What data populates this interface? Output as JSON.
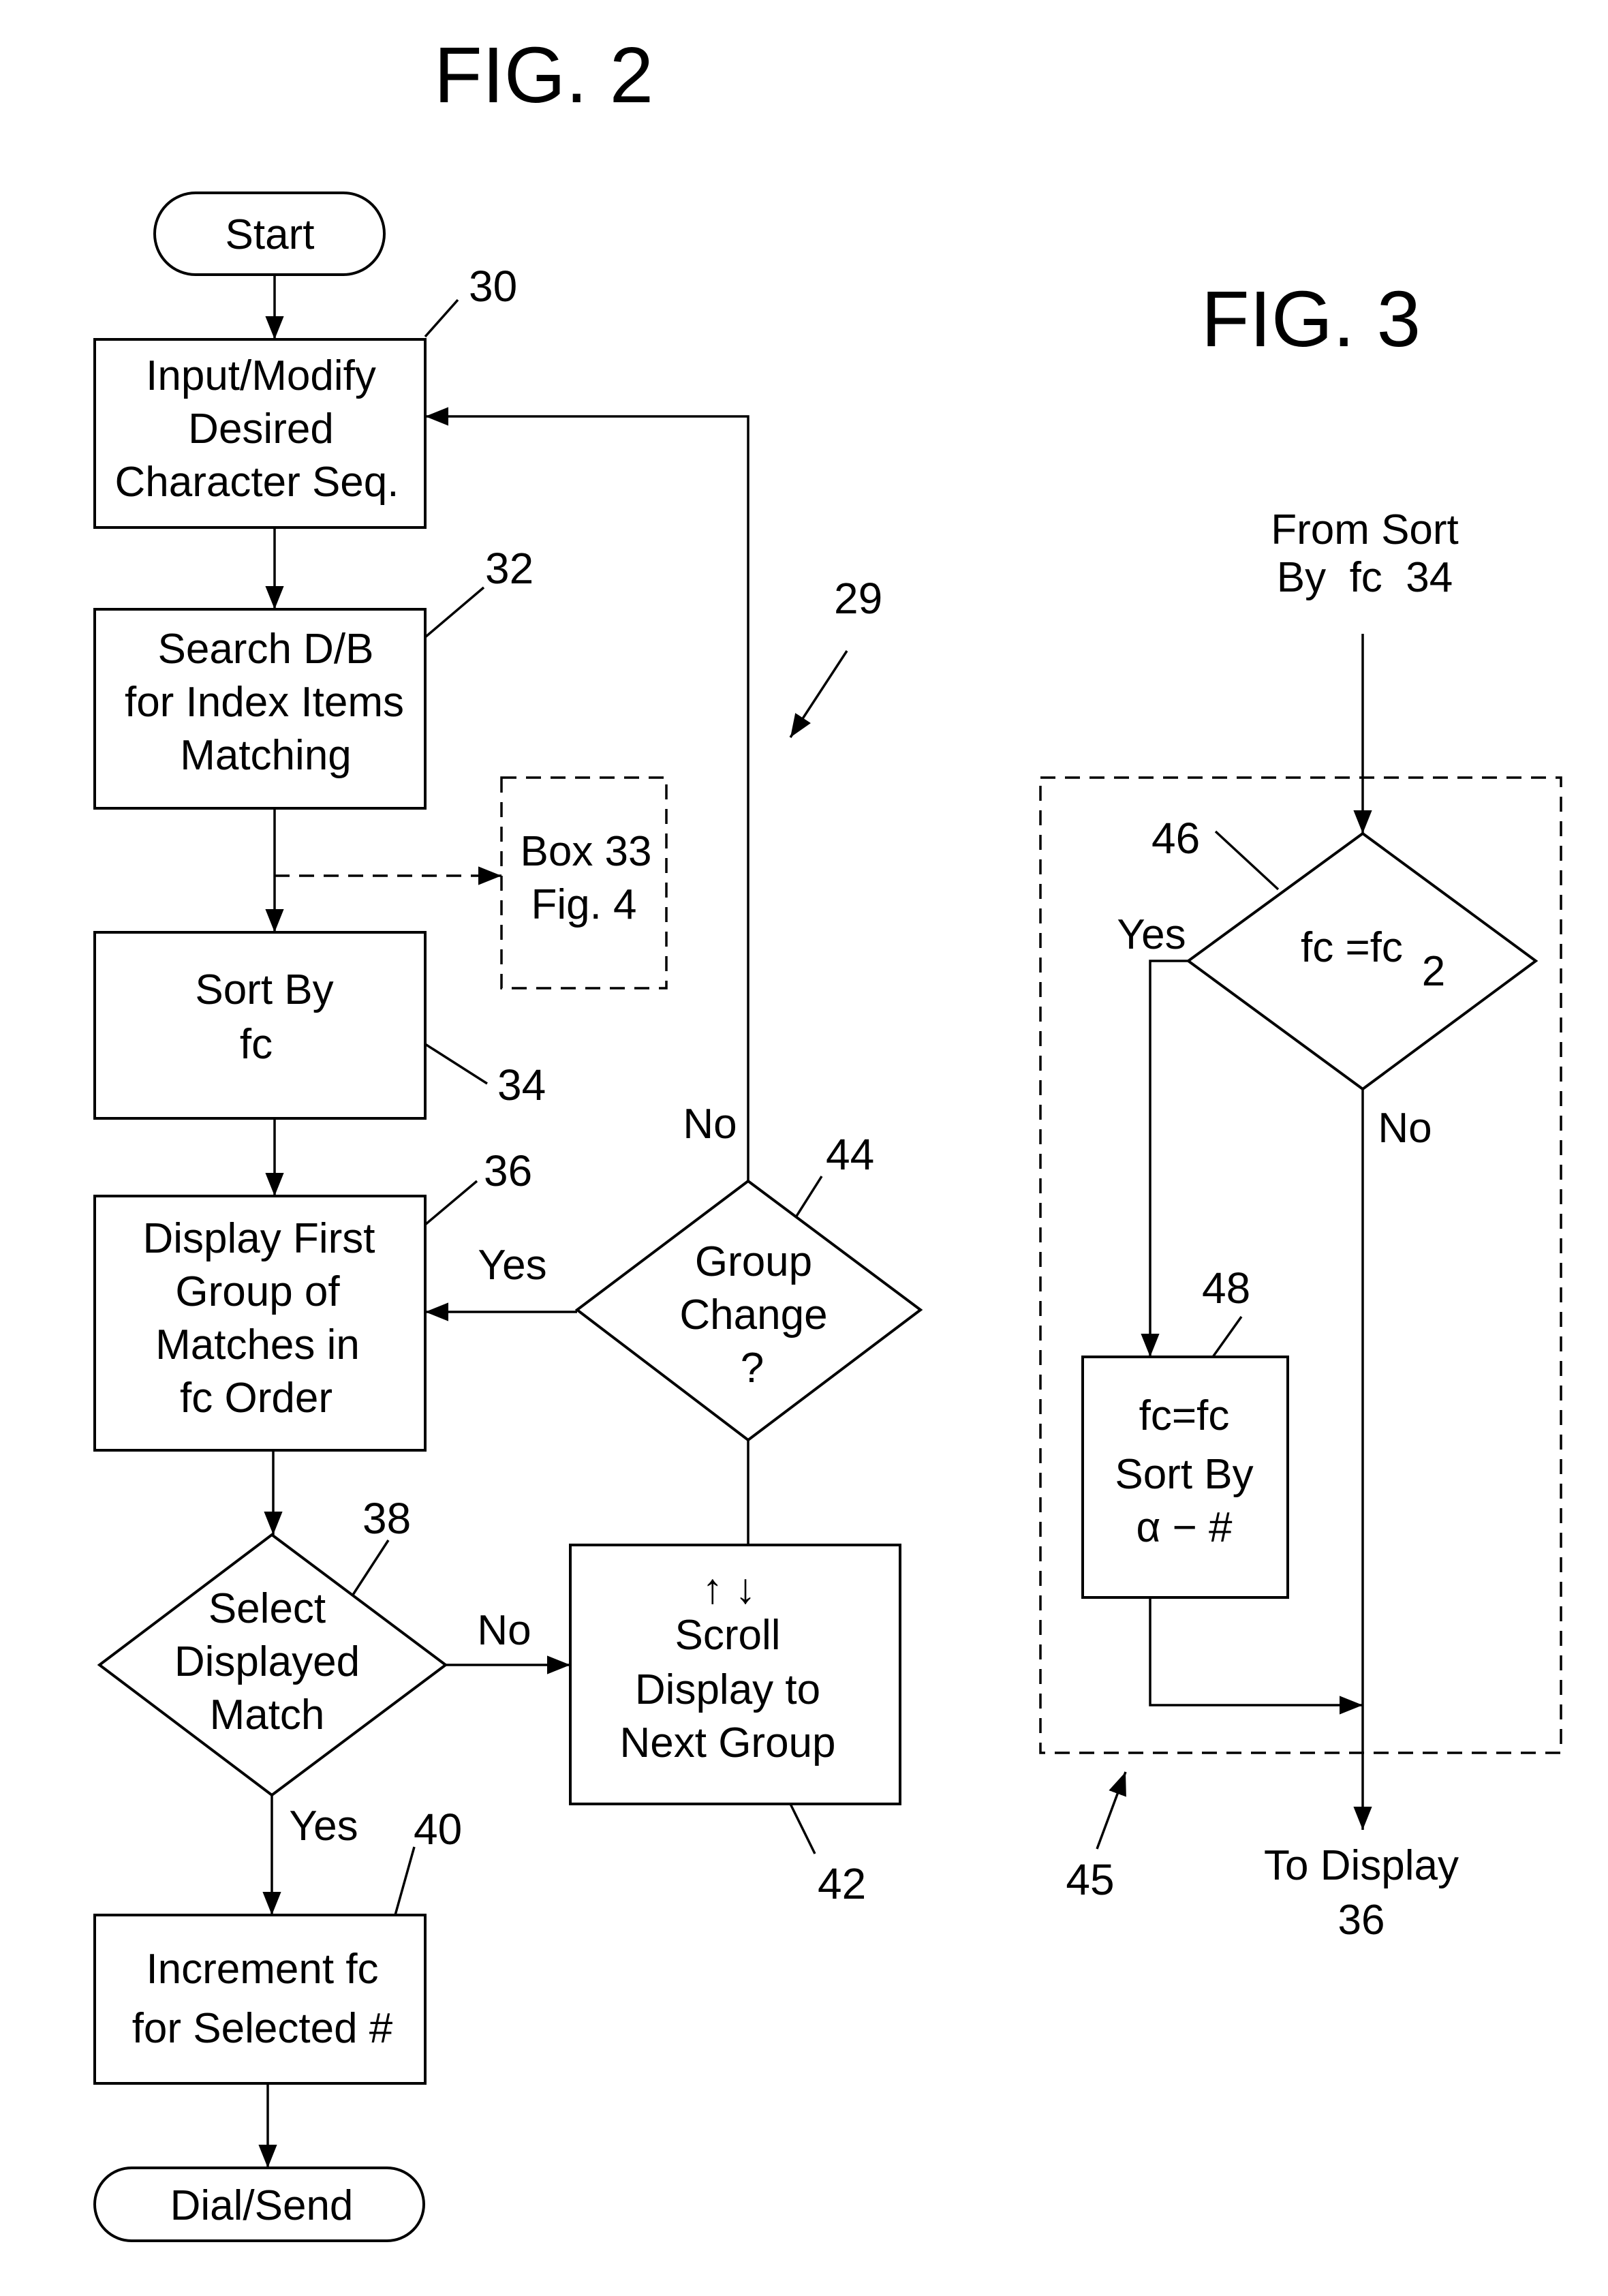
{
  "fig2": {
    "title": "FIG. 2",
    "start": "Start",
    "box30": {
      "lines": [
        "Input/Modify",
        "Desired",
        "Character Seq."
      ],
      "ref": "30"
    },
    "box32": {
      "lines": [
        "Search D/B",
        "for Index Items",
        "Matching"
      ],
      "ref": "32"
    },
    "box33": {
      "lines": [
        "Box 33",
        "Fig. 4"
      ]
    },
    "box34": {
      "lines": [
        "Sort By",
        "fc"
      ],
      "ref": "34"
    },
    "box36": {
      "lines": [
        "Display First",
        "Group of",
        "Matches in",
        "fc Order"
      ],
      "ref": "36"
    },
    "diamond38": {
      "lines": [
        "Select",
        "Displayed",
        "Match"
      ],
      "ref": "38"
    },
    "box40": {
      "lines": [
        "Increment  fc",
        "for Selected #"
      ],
      "ref": "40"
    },
    "box42": {
      "lines": [
        "Scroll",
        "Display to",
        "Next Group"
      ],
      "ref": "42",
      "arrows": "↑ ↓"
    },
    "diamond44": {
      "lines": [
        "Group",
        "Change",
        "?"
      ],
      "ref": "44"
    },
    "end": "Dial/Send",
    "loop_ref": "29",
    "labels": {
      "yes_36": "Yes",
      "no_44": "No",
      "no_38": "No",
      "yes_38": "Yes"
    }
  },
  "fig3": {
    "title": "FIG. 3",
    "from": [
      "From Sort",
      "By  fc  34"
    ],
    "diamond46": {
      "text": "fc =fc",
      "subscript": "2",
      "ref": "46"
    },
    "box48": {
      "lines": [
        "fc=fc",
        "Sort By",
        "α − #"
      ],
      "ref": "48"
    },
    "group_ref": "45",
    "to": [
      "To Display",
      "36"
    ],
    "labels": {
      "yes": "Yes",
      "no": "No"
    }
  }
}
